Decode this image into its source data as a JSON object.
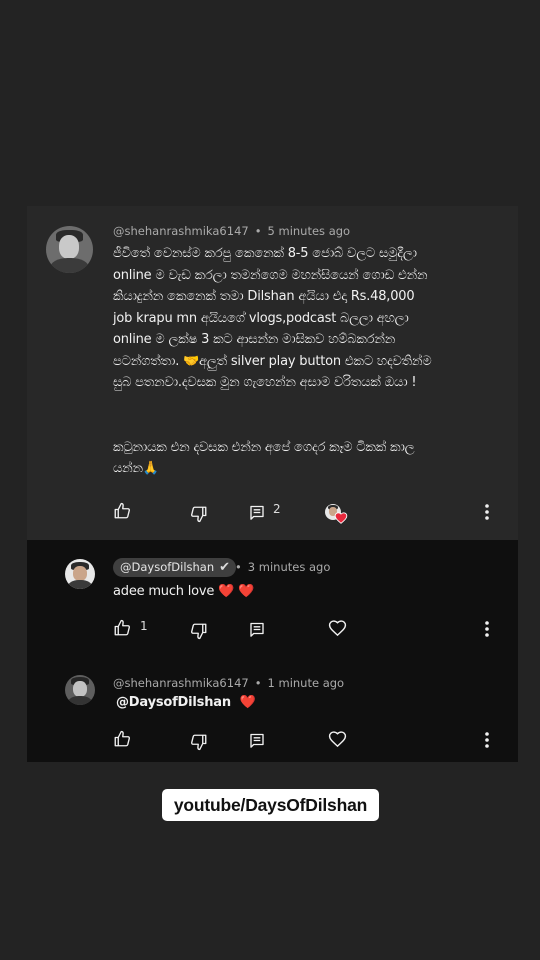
{
  "top_comment": {
    "author": "@shehanrashmika6147",
    "time": "5 minutes ago",
    "lines": [
      "ජීවිතේ වෙනස්ම කරපු කෙනෙක් 8-5 ජොබ් වලට සමුදීලා",
      "online ම වැඩ කරලා තමන්ගෙම මහන්සියෙන් ගොඩ එන්න",
      "කියාදුන්න කෙනෙක් තමා Dilshan අයියා එදා Rs.48,000",
      "job krapu mn අයියගේ vlogs,podcast බලලා අහලා",
      "online ම ලක්ෂ 3 කට ආසන්න මාසිකව හම්බකරන්න",
      "පටන්ගත්තා. 🤝අලුත් silver play button එකට හදවතින්ම",
      "සුබ පතනවා.දවසක මුන ගැහෙන්න අසාම වරිතයක් ඔයා !",
      "",
      "",
      "කටුනායක එන දවසක එන්න අපේ ගෙදර කෑම ටිකක් කාල",
      "යන්න🙏"
    ],
    "reply_count": "2"
  },
  "reply_1": {
    "author": "@DaysofDilshan",
    "check": "✔",
    "time": "3 minutes ago",
    "text": "adee much love ❤️ ❤️",
    "like_count": "1"
  },
  "reply_2": {
    "author": "@shehanrashmika6147",
    "time": "1 minute ago",
    "mention": "@DaysofDilshan",
    "heart": "❤️"
  },
  "banner": "youtube/DaysOfDilshan",
  "icons": [
    "thumb-up-icon",
    "thumb-down-icon",
    "reply-icon",
    "heart-icon",
    "more-vertical-icon"
  ],
  "colors": {
    "background": "#232323",
    "comment_bg": "#282828",
    "reply_bg": "#0f0f0f",
    "heart": "#e8283c"
  }
}
